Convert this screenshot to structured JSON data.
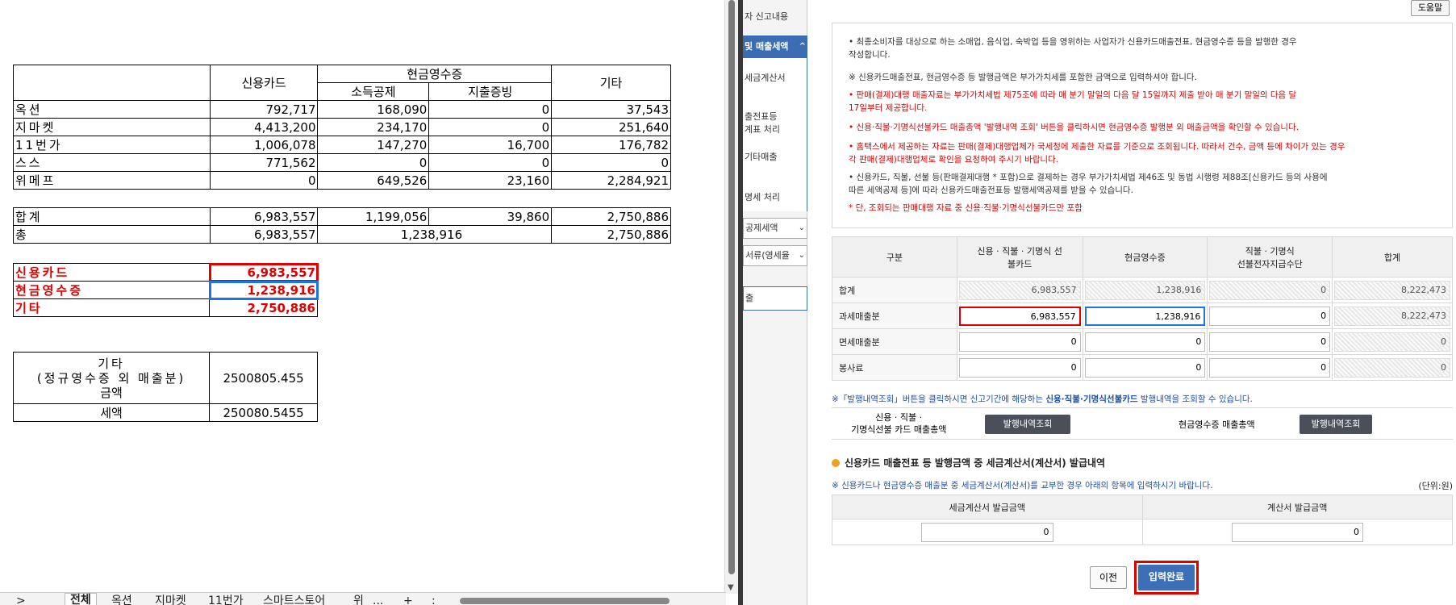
{
  "sheet": {
    "headers": {
      "credit": "신용카드",
      "cash": "현금영수증",
      "income": "소득공제",
      "expense": "지출증빙",
      "other": "기타"
    },
    "rows": [
      {
        "label": "옥션",
        "credit": "792,717",
        "income": "168,090",
        "expense": "0",
        "other": "37,543"
      },
      {
        "label": "지마켓",
        "credit": "4,413,200",
        "income": "234,170",
        "expense": "0",
        "other": "251,640"
      },
      {
        "label": "11번가",
        "credit": "1,006,078",
        "income": "147,270",
        "expense": "16,700",
        "other": "176,782"
      },
      {
        "label": "스스",
        "credit": "771,562",
        "income": "0",
        "expense": "0",
        "other": "0"
      },
      {
        "label": "위메프",
        "credit": "0",
        "income": "649,526",
        "expense": "23,160",
        "other": "2,284,921"
      }
    ],
    "sum": {
      "label": "합계",
      "credit": "6,983,557",
      "income": "1,199,056",
      "expense": "39,860",
      "other": "2,750,886"
    },
    "total": {
      "label": "총",
      "credit": "6,983,557",
      "cash": "1,238,916",
      "other": "2,750,886"
    },
    "summary": [
      {
        "label": "신용카드",
        "value": "6,983,557"
      },
      {
        "label": "현금영수증",
        "value": "1,238,916"
      },
      {
        "label": "기타",
        "value": "2,750,886"
      }
    ],
    "calc": {
      "label1": "기타",
      "label2": "(정규영수증 외 매출분)",
      "label3": "금액",
      "value1": "2500805.455",
      "label4": "세액",
      "value2": "250080.5455"
    },
    "tabs": [
      ">",
      "전체",
      "옥션",
      "지마켓",
      "11번가",
      "스마트스토어",
      "위",
      "...",
      "+",
      ":"
    ]
  },
  "nav": {
    "item0": "자 신고내용",
    "item1": "및 매출세액",
    "item2": "세금계산서",
    "item3a": "출전표등",
    "item3b": "계표 처리",
    "item4": "기타매출",
    "item5": "명세 처리",
    "item6": "공제세액",
    "item7": "서류(영세율",
    "item8": "출",
    "chev": "⌄",
    "up": "^"
  },
  "form": {
    "help": "도움말",
    "notice": [
      "• 최종소비자를 대상으로 하는 소매업, 음식업, 숙박업 등을 영위하는 사업자가 신용카드매출전표, 현금영수증 등을 발행한 경우",
      "  작성합니다.",
      "※ 신용카드매출전표, 현금영수증 등 발행금액은 부가가치세를 포함한 금액으로 입력하셔야 합니다.",
      "• 판매(결제)대행 매출자료는 부가가치세법 제75조에 따라 매 분기 말일의 다음 달 15일까지 제출 받아 매 분기 말일의 다음 달",
      "  17일부터 제공합니다.",
      "• 신용·직불·기명식선불카드 매출총액 '발행내역 조회' 버튼을 클릭하시면 현금영수증 발행분 외 매출금액을 확인할 수 있습니다.",
      "• 홈택스에서 제공하는 자료는 판매(결제)대행업체가 국세청에 제출한 자료를 기준으로 조회됩니다. 따라서 건수, 금액 등에 차이가  있는 경우",
      "  각 판매(결제)대행업체로 확인을 요청하여 주시기 바랍니다.",
      "• 신용카드, 직불, 선불 등(판매결제대행 * 포함)으로 결제하는 경우 부가가치세법 제46조 및 동법 시행령 제88조[신용카드 등의 사용에",
      "  따른 세액공제 등]에 따라  신용카드매출전표등 발행세액공제를 받을 수 있습니다.",
      "* 단, 조회되는 판매대행 자료 중 신용·직불·기명식선불카드만 포함"
    ],
    "table": {
      "h_kind": "구분",
      "h_credit1": "신용 · 직불 · 기명식 선",
      "h_credit2": "불카드",
      "h_cash": "현금영수증",
      "h_debit1": "직불 · 기명식",
      "h_debit2": "선불전자지급수단",
      "h_total": "합계",
      "rows": [
        {
          "label": "합계",
          "credit": "6,983,557",
          "cash": "1,238,916",
          "debit": "0",
          "total": "8,222,473"
        },
        {
          "label": "과세매출분",
          "credit": "6,983,557",
          "cash": "1,238,916",
          "debit": "0",
          "total": "8,222,473"
        },
        {
          "label": "면세매출분",
          "credit": "0",
          "cash": "0",
          "debit": "0",
          "total": "0"
        },
        {
          "label": "봉사료",
          "credit": "0",
          "cash": "0",
          "debit": "0",
          "total": "0"
        }
      ]
    },
    "hint1_a": "※「발행내역조회」버튼을 클릭하시면 신고기간에 해당하는 ",
    "hint1_b": "신용·직불·기명식선불카드",
    "hint1_c": " 발행내역을 조회할 수 있습니다.",
    "issue_label1": "신용 · 직불 ·",
    "issue_label2": "기명식선불 카드 매출총액",
    "issue_btn1": "발행내역조회",
    "issue_label3": "현금영수증 매출총액",
    "issue_btn2": "발행내역조회",
    "section_title": "신용카드 매출전표 등 발행금액 중 세금계산서(계산서) 발급내역",
    "hint2": "※ 신용카드나 현금영수증 매출분 중 세금계산서(계산서)를 교부한 경우 아래의 항목에 입력하시기 바랍니다.",
    "unit": "(단위:원)",
    "tax_h1": "세금계산서 발급금액",
    "tax_h2": "계산서 발급금액",
    "tax_v1": "0",
    "tax_v2": "0",
    "prev": "이전",
    "done": "입력완료"
  },
  "colors": {
    "accent": "#3d6fb8",
    "highlight_red": "#e00000",
    "highlight_blue": "#1e73e8"
  }
}
